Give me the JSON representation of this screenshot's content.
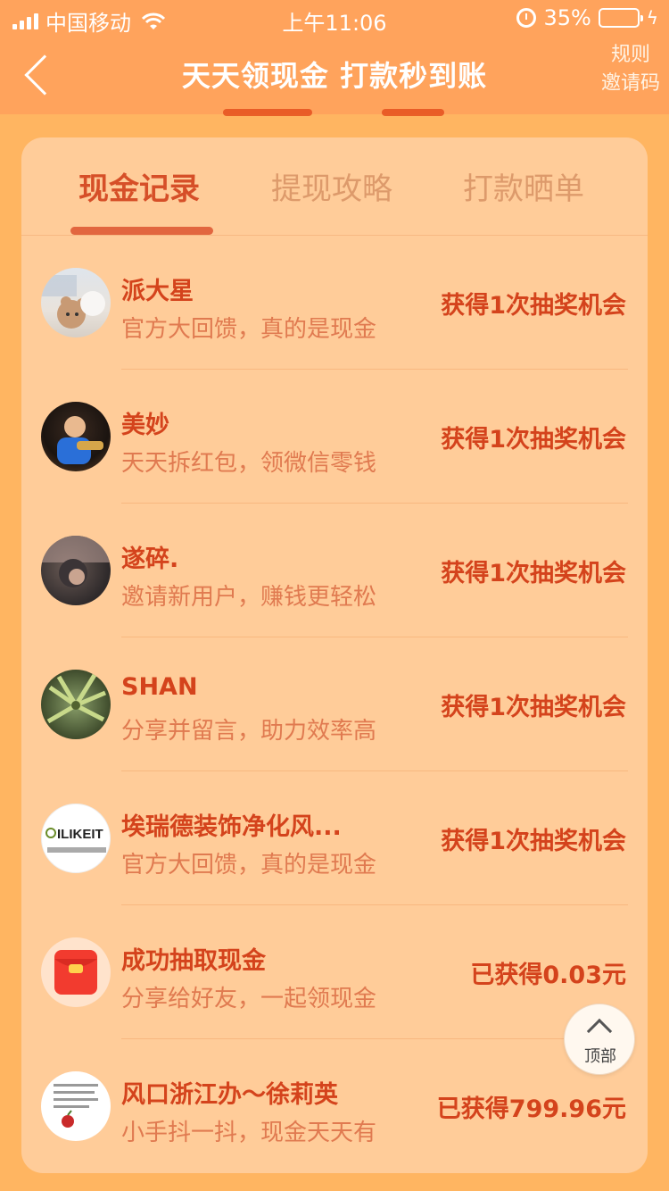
{
  "status_bar": {
    "carrier": "中国移动",
    "time": "上午11:06",
    "battery": "35%",
    "battery_level": 0.35
  },
  "nav": {
    "title": "天天领现金 打款秒到账",
    "rules": "规则",
    "invite_code": "邀请码"
  },
  "tabs": [
    {
      "label": "现金记录",
      "active": true
    },
    {
      "label": "提现攻略",
      "active": false
    },
    {
      "label": "打款晒单",
      "active": false
    }
  ],
  "records": [
    {
      "name": "派大星",
      "desc": "官方大回馈，真的是现金",
      "reward": "获得1次抽奖机会"
    },
    {
      "name": "美妙",
      "desc": "天天拆红包，领微信零钱",
      "reward": "获得1次抽奖机会"
    },
    {
      "name": "遂碎.",
      "desc": "邀请新用户，赚钱更轻松",
      "reward": "获得1次抽奖机会"
    },
    {
      "name": "SHAN",
      "desc": "分享并留言，助力效率高",
      "reward": "获得1次抽奖机会"
    },
    {
      "name": "埃瑞德装饰净化风...",
      "desc": "官方大回馈，真的是现金",
      "reward": "获得1次抽奖机会"
    },
    {
      "name": "成功抽取现金",
      "desc": "分享给好友，一起领现金",
      "reward": "已获得0.03元"
    },
    {
      "name": "风口浙江办～徐莉英",
      "desc": "小手抖一抖，现金天天有",
      "reward": "已获得799.96元"
    }
  ],
  "avatar5_text": "ILIKEIT",
  "back_to_top": "顶部",
  "colors": {
    "accent": "#d4431c",
    "nav_bg": "#ffa35c",
    "card_bg": "#ffcc99"
  }
}
